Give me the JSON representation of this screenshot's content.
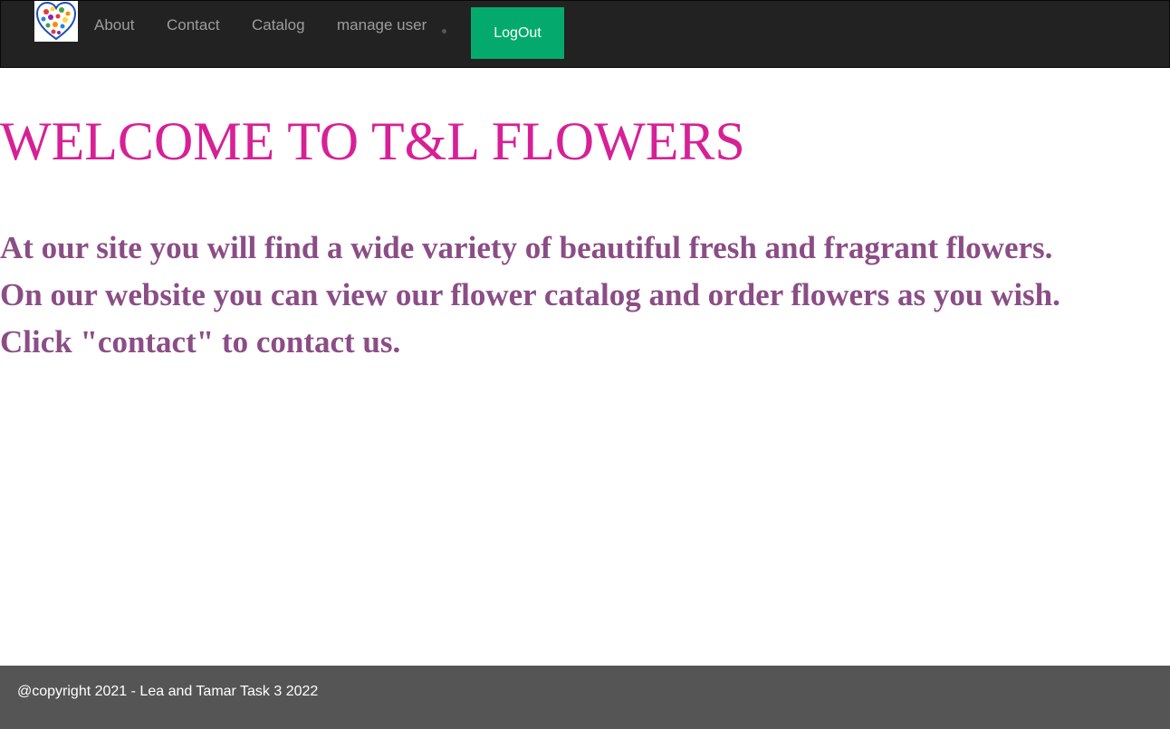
{
  "navbar": {
    "logo_icon": "heart-flowers-logo",
    "links": [
      "About",
      "Contact",
      "Catalog",
      "manage user"
    ],
    "logout_label": "LogOut"
  },
  "main": {
    "title": "WELCOME TO T&L FLOWERS",
    "lines": [
      "At our site you will find a wide variety of beautiful fresh and fragrant flowers.",
      "On our website you can view our flower catalog and order flowers as you wish.",
      "Click \"contact\" to contact us."
    ]
  },
  "footer": {
    "text": "@copyright 2021 - Lea and Tamar Task 3 2022"
  },
  "colors": {
    "navbar_bg": "#222222",
    "nav_link": "#9d9d9d",
    "logout_bg": "#04aa6d",
    "title": "#d62196",
    "body_text": "#8b4d86",
    "footer_bg": "#555555"
  }
}
